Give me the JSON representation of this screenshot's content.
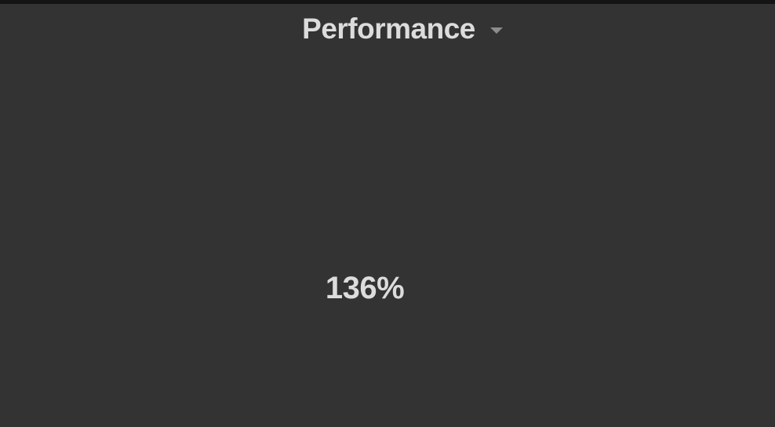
{
  "panel": {
    "title": "Performance",
    "menu_icon": "chevron-down-icon",
    "value": "136%"
  },
  "colors": {
    "background": "#333333",
    "top_border": "#141414",
    "text": "#dcdcdc",
    "caret": "#8c8c8c"
  }
}
